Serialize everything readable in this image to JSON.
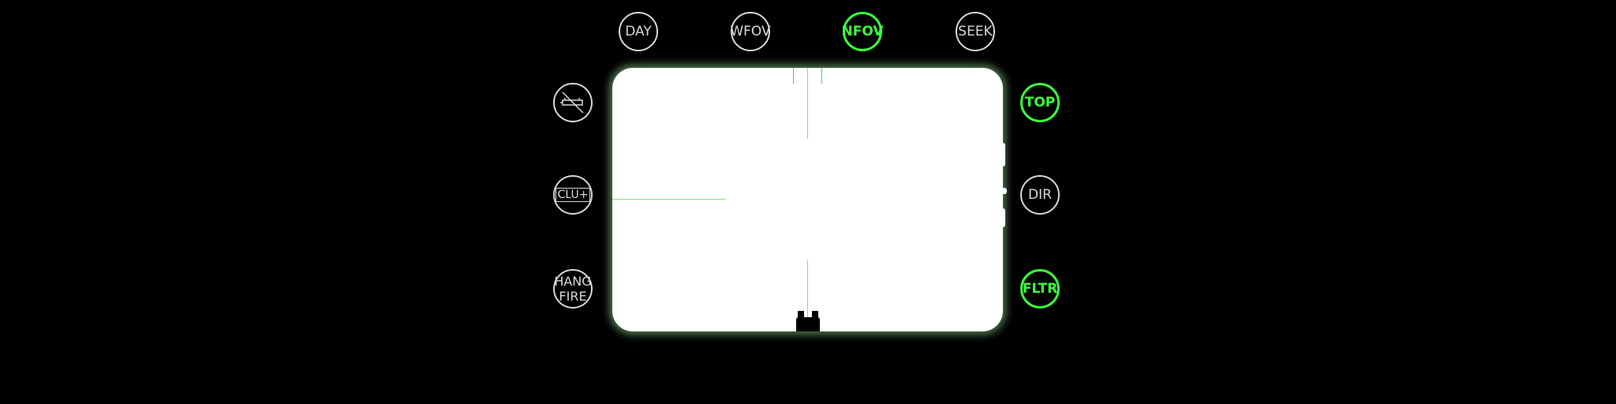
{
  "top_buttons": {
    "day": "DAY",
    "wfov": "WFOV",
    "nfov": "NFOV",
    "seek": "SEEK"
  },
  "left_buttons": {
    "no_missile_icon": "no-missile-icon",
    "clu": "CLU+",
    "hang_line1": "HANG",
    "hang_line2": "FIRE"
  },
  "right_buttons": {
    "top": "TOP",
    "dir": "DIR",
    "fltr": "FLTR"
  },
  "colors": {
    "active": "#3cff3c",
    "inactive": "#d8d8d8",
    "screen": "#ffffff",
    "reticle": "#7ee07e"
  },
  "active_states": {
    "nfov": true,
    "top": true,
    "fltr": true
  }
}
